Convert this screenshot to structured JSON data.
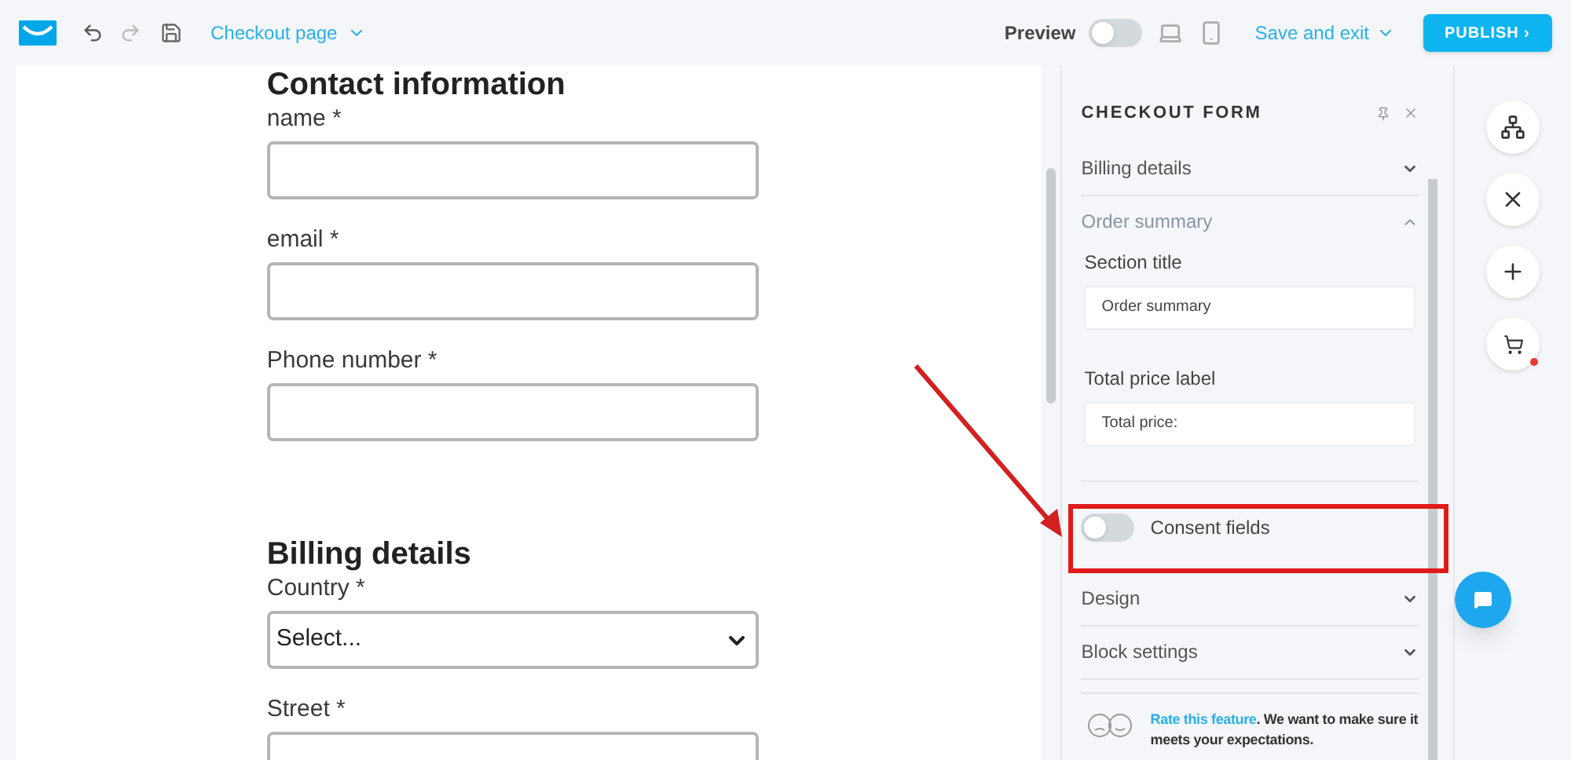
{
  "topbar": {
    "page_name": "Checkout page",
    "preview_label": "Preview",
    "preview_on": false,
    "save_label": "Save and exit",
    "publish_label": "PUBLISH ›"
  },
  "form": {
    "sections": [
      {
        "title": "Contact information",
        "fields": [
          {
            "label": "name *",
            "kind": "text"
          },
          {
            "label": "email *",
            "kind": "text"
          },
          {
            "label": "Phone number *",
            "kind": "text"
          }
        ]
      },
      {
        "title": "Billing details",
        "fields": [
          {
            "label": "Country *",
            "kind": "select",
            "value": "Select..."
          },
          {
            "label": "Street *",
            "kind": "text"
          }
        ]
      }
    ]
  },
  "panel": {
    "title": "CHECKOUT FORM",
    "items": [
      {
        "kind": "accordion",
        "label": "Billing details",
        "expanded": false
      },
      {
        "kind": "accordion",
        "label": "Order summary",
        "expanded": true,
        "fields": [
          {
            "label": "Section title",
            "value": "Order summary"
          },
          {
            "label": "Total price label",
            "value": "Total price:"
          }
        ]
      },
      {
        "kind": "toggle",
        "label": "Consent fields",
        "on": false
      },
      {
        "kind": "accordion",
        "label": "Design",
        "expanded": false
      },
      {
        "kind": "accordion",
        "label": "Block settings",
        "expanded": false
      }
    ],
    "rate": {
      "link": "Rate this feature",
      "text": ". We want to make sure it meets your expectations."
    }
  }
}
